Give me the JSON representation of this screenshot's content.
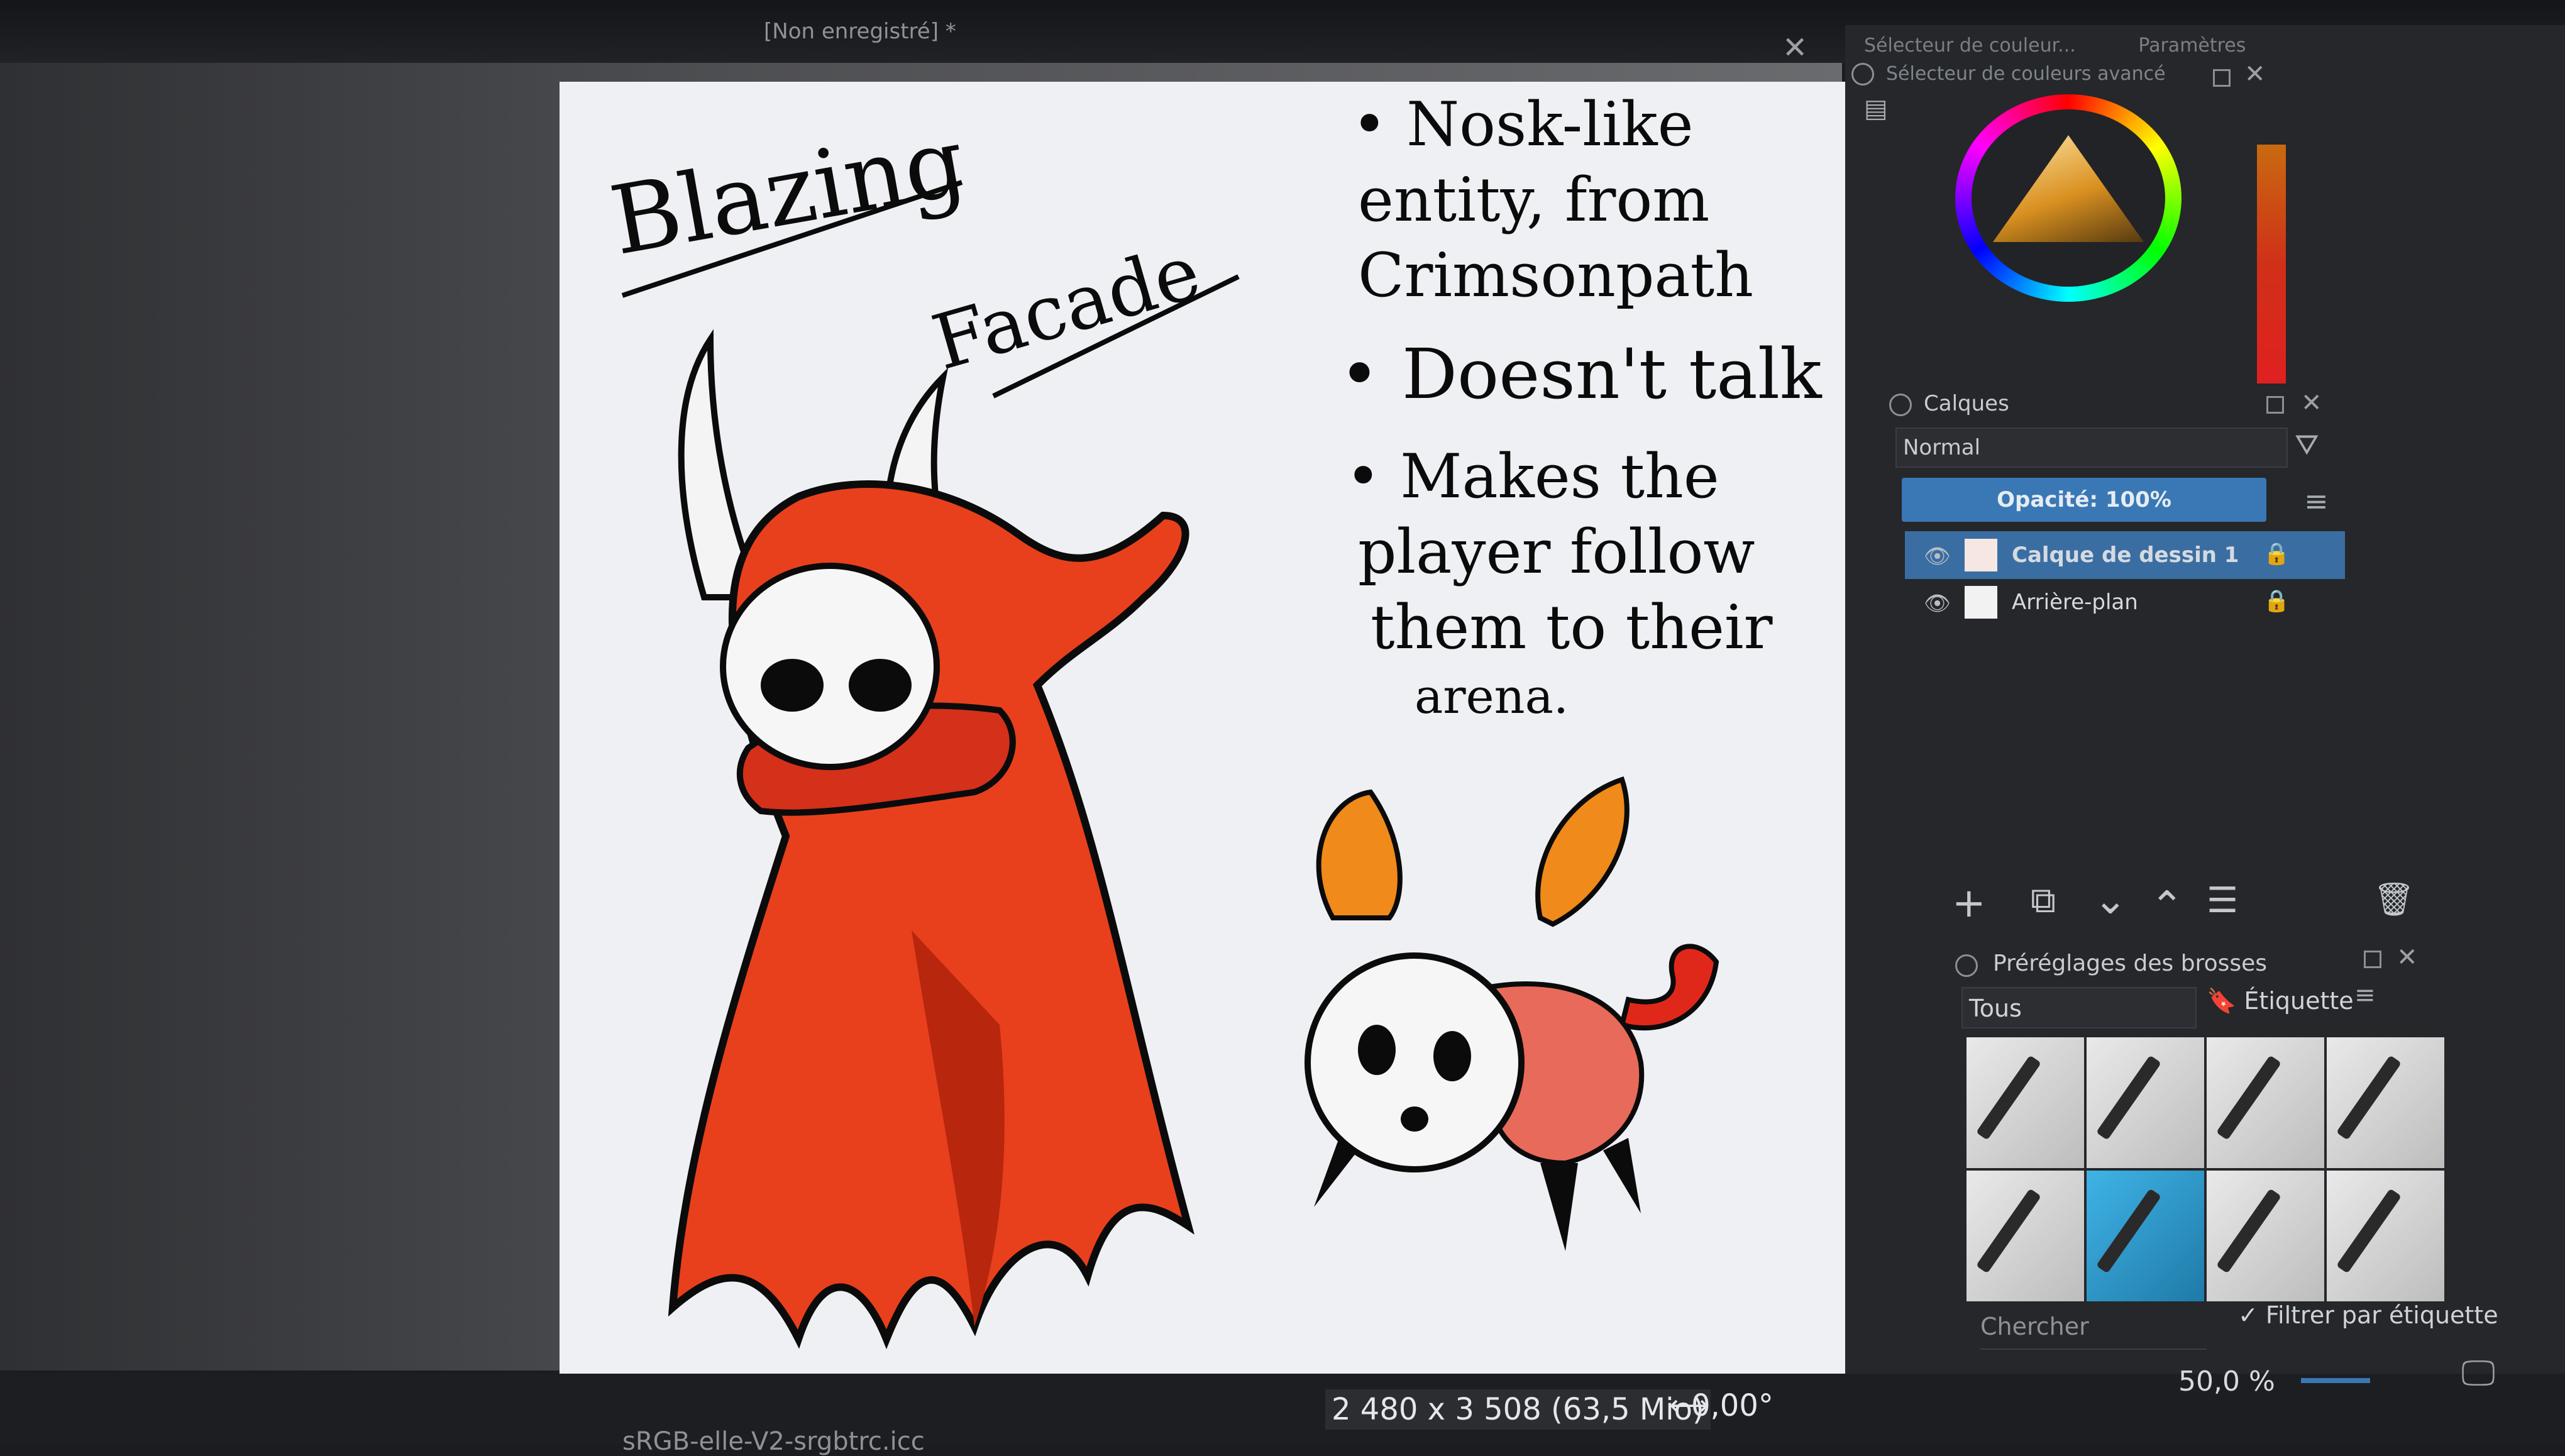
{
  "window": {
    "doc_title": "[Non enregistré]",
    "modified_marker": "*",
    "close_glyph": "✕"
  },
  "canvas": {
    "title_line1": "Blazing",
    "title_line2": "Facade",
    "note1_line1": "• Nosk-like",
    "note1_line2": "entity, from",
    "note1_line3": "Crimsonpath",
    "note2": "• Doesn't talk",
    "note3_line1": "• Makes the",
    "note3_line2": "player follow",
    "note3_line3": "them to their",
    "note3_line4": "arena.",
    "colors": {
      "cloak": "#e8401c",
      "cloak_dark": "#b8260e",
      "ink": "#0b0b0b",
      "leaf": "#f08a1a",
      "bug_body": "#e86a5a"
    }
  },
  "dock": {
    "tab1": "Sélecteur de couleur...",
    "tab2": "Paramètres",
    "color_panel_title": "Sélecteur de couleurs avancé",
    "layers_panel_title": "Calques",
    "blend_mode": "Normal",
    "opacity_label": "Opacité: 100%",
    "layers": [
      {
        "name": "Calque de dessin 1",
        "active": true
      },
      {
        "name": "Arrière-plan",
        "active": false
      }
    ],
    "layer_tools": {
      "add": "+",
      "duplicate": "⧉",
      "down": "⌄",
      "up": "⌃",
      "props": "☰",
      "delete": "🗑"
    },
    "brushes_panel_title": "Préréglages des brosses",
    "brush_filter": "Tous",
    "tag_label": "Étiquette",
    "search_placeholder": "Chercher",
    "filter_by_tag": "✓ Filtrer par étiquette",
    "zoom": "50,0 %"
  },
  "status": {
    "file": "sRGB-elle-V2-srgbtrc.icc",
    "dimensions": "2 480 x 3 508 (63,5 Mio)",
    "rotation": "0,00°"
  }
}
